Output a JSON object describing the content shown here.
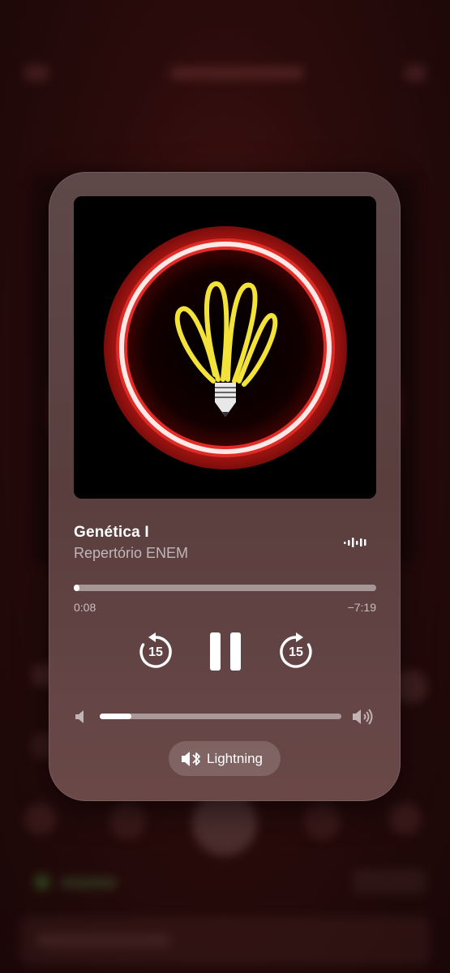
{
  "now_playing": {
    "title": "Genética I",
    "artist": "Repertório ENEM",
    "elapsed": "0:08",
    "remaining": "−7:19",
    "progress_fraction": 0.018,
    "skip_back_seconds": "15",
    "skip_forward_seconds": "15",
    "volume_fraction": 0.13,
    "output_route": "Lightning"
  },
  "icons": {
    "airplay": "audio-waveform-icon",
    "skip_back": "gobackward-15-icon",
    "pause": "pause-icon",
    "skip_forward": "goforward-15-icon",
    "volume_min": "speaker-icon",
    "volume_max": "speaker-wave-icon",
    "route": "speaker-bluetooth-icon"
  },
  "colors": {
    "accent_ring": "#e8302a",
    "bulb_yellow": "#f2e23a"
  }
}
